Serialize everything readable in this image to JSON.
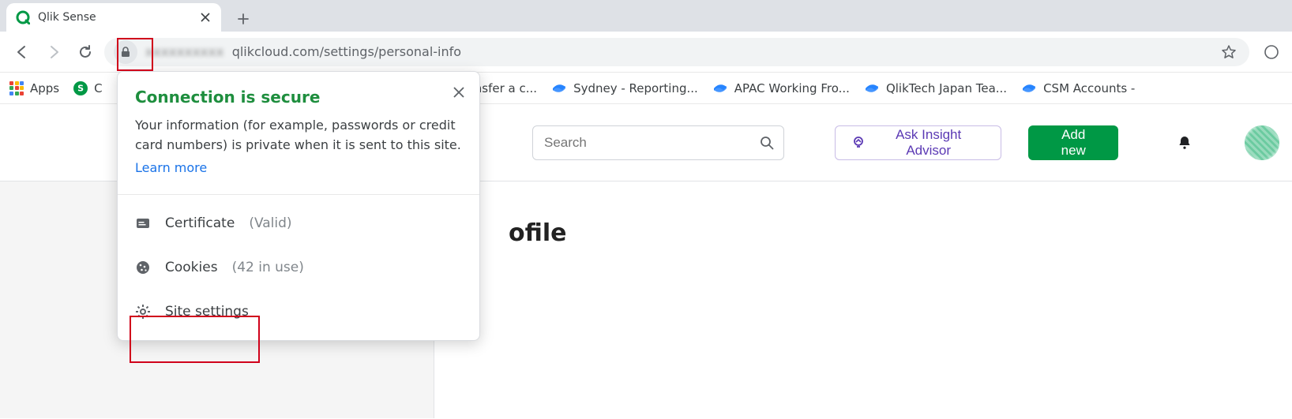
{
  "browser": {
    "tab": {
      "title": "Qlik Sense"
    },
    "url_hidden_part": "xxxxxxxxxx",
    "url_visible_part": "qlikcloud.com/settings/personal-info"
  },
  "bookmarks": {
    "apps_label": "Apps",
    "bm1_clipped": "C",
    "bm_transfer": "o transfer a c...",
    "bm_sydney": "Sydney - Reporting...",
    "bm_apac": "APAC Working Fro...",
    "bm_qliktech": "QlikTech Japan Tea...",
    "bm_csm": "CSM Accounts -"
  },
  "popover": {
    "title": "Connection is secure",
    "desc": "Your information (for example, passwords or credit card numbers) is private when it is sent to this site.",
    "learn_more": "Learn more",
    "cert_label": "Certificate",
    "cert_state": "(Valid)",
    "cookies_label": "Cookies",
    "cookies_count": "(42 in use)",
    "site_settings": "Site settings"
  },
  "app": {
    "search_placeholder": "Search",
    "ask_label": "Ask Insight Advisor",
    "add_label": "Add new",
    "main_title_clipped": "ofile",
    "notifications_label": "Notifications"
  }
}
